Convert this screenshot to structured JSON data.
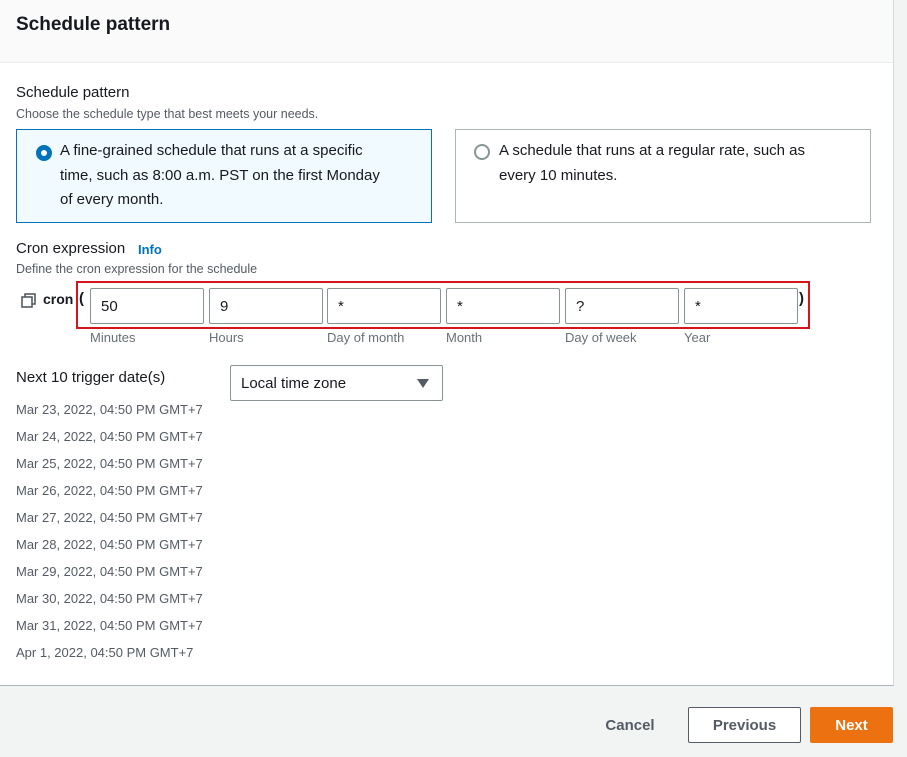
{
  "panel": {
    "title": "Schedule pattern"
  },
  "pattern": {
    "label": "Schedule pattern",
    "description": "Choose the schedule type that best meets your needs.",
    "options": [
      {
        "line1": "A fine-grained schedule that runs at a specific",
        "line2": "time, such as 8:00 a.m. PST on the first Monday",
        "line3": "of every month.",
        "selected": true
      },
      {
        "line1": "A schedule that runs at a regular rate, such as",
        "line2": "every 10 minutes.",
        "selected": false
      }
    ]
  },
  "cron": {
    "label": "Cron expression",
    "info": "Info",
    "description": "Define the cron expression for the schedule",
    "prefix": "cron",
    "open_paren": "(",
    "close_paren": ")",
    "fields": [
      {
        "value": "50",
        "label": "Minutes"
      },
      {
        "value": "9",
        "label": "Hours"
      },
      {
        "value": "*",
        "label": "Day of month"
      },
      {
        "value": "*",
        "label": "Month"
      },
      {
        "value": "?",
        "label": "Day of week"
      },
      {
        "value": "*",
        "label": "Year"
      }
    ]
  },
  "triggers": {
    "label": "Next 10 trigger date(s)",
    "timezone": "Local time zone",
    "dates": [
      "Mar 23, 2022, 04:50 PM GMT+7",
      "Mar 24, 2022, 04:50 PM GMT+7",
      "Mar 25, 2022, 04:50 PM GMT+7",
      "Mar 26, 2022, 04:50 PM GMT+7",
      "Mar 27, 2022, 04:50 PM GMT+7",
      "Mar 28, 2022, 04:50 PM GMT+7",
      "Mar 29, 2022, 04:50 PM GMT+7",
      "Mar 30, 2022, 04:50 PM GMT+7",
      "Mar 31, 2022, 04:50 PM GMT+7",
      "Apr 1, 2022, 04:50 PM GMT+7"
    ]
  },
  "footer": {
    "cancel": "Cancel",
    "previous": "Previous",
    "next": "Next"
  },
  "colors": {
    "accent": "#0073bb",
    "primary_button": "#ec7211",
    "highlight": "#d7131c"
  }
}
